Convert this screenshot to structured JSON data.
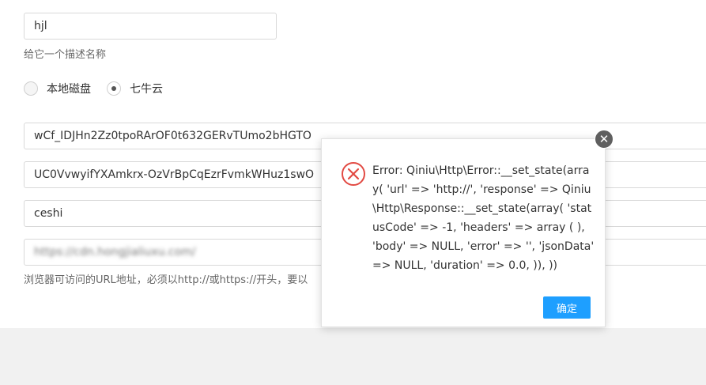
{
  "form": {
    "name_value": "hjl",
    "name_hint": "给它一个描述名称",
    "storage_options": [
      {
        "label": "本地磁盘",
        "checked": false
      },
      {
        "label": "七牛云",
        "checked": true
      }
    ],
    "access_key_value": "wCf_IDJHn2Zz0tpoRArOF0t632GERvTUmo2bHGTO",
    "secret_key_value": "UC0VvwyifYXAmkrx-OzVrBpCqEzrFvmkWHuz1swO",
    "bucket_value": "ceshi",
    "url_value": "https://cdn.hongjialiuxu.com/",
    "url_hint": "浏览器可访问的URL地址，必须以http://或https://开头，要以"
  },
  "dialog": {
    "message": "Error: Qiniu\\Http\\Error::__set_state(array( 'url' => 'http://', 'response' => Qiniu\\Http\\Response::__set_state(array( 'statusCode' => -1, 'headers' => array ( ), 'body' => NULL, 'error' => '', 'jsonData' => NULL, 'duration' => 0.0, )), ))",
    "ok_label": "确定",
    "icon": "error-circle-icon",
    "close_icon": "close-icon"
  }
}
